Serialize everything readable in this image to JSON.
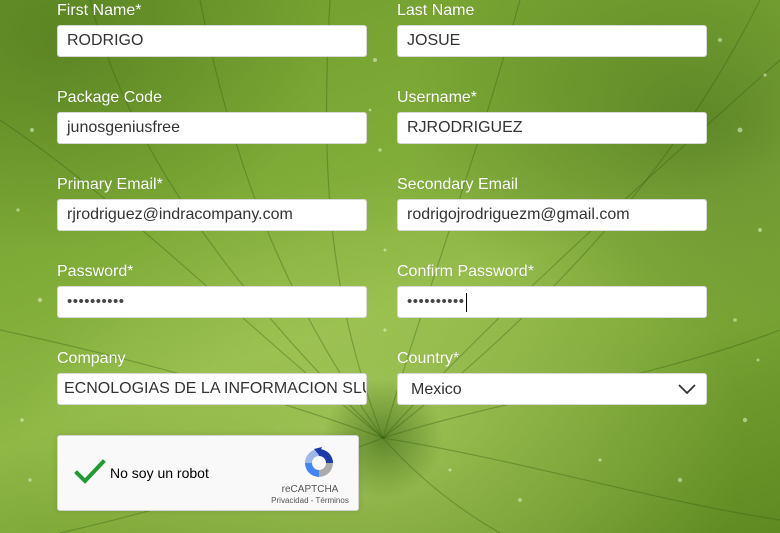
{
  "form": {
    "first_name": {
      "label": "First Name*",
      "value": "RODRIGO"
    },
    "last_name": {
      "label": "Last Name",
      "value": "JOSUE"
    },
    "package_code": {
      "label": "Package Code",
      "value": "junosgeniusfree"
    },
    "username": {
      "label": "Username*",
      "value": "RJRODRIGUEZ"
    },
    "primary_email": {
      "label": "Primary Email*",
      "value": "rjrodriguez@indracompany.com"
    },
    "secondary_email": {
      "label": "Secondary Email",
      "value": "rodrigojrodriguezm@gmail.com"
    },
    "password": {
      "label": "Password*",
      "value": "••••••••••"
    },
    "confirm_password": {
      "label": "Confirm Password*",
      "value": "••••••••••"
    },
    "company": {
      "label": "Company",
      "value": "ECNOLOGIAS DE LA INFORMACION SLU"
    },
    "country": {
      "label": "Country*",
      "selected": "Mexico",
      "icon": "chevron-down-icon"
    }
  },
  "recaptcha": {
    "label": "No soy un robot",
    "brand": "reCAPTCHA",
    "links": "Privacidad - Términos",
    "checked": true,
    "check_color": "#1e9c34"
  },
  "colors": {
    "background_green": "#7fab37",
    "label_text": "#ffffff"
  }
}
